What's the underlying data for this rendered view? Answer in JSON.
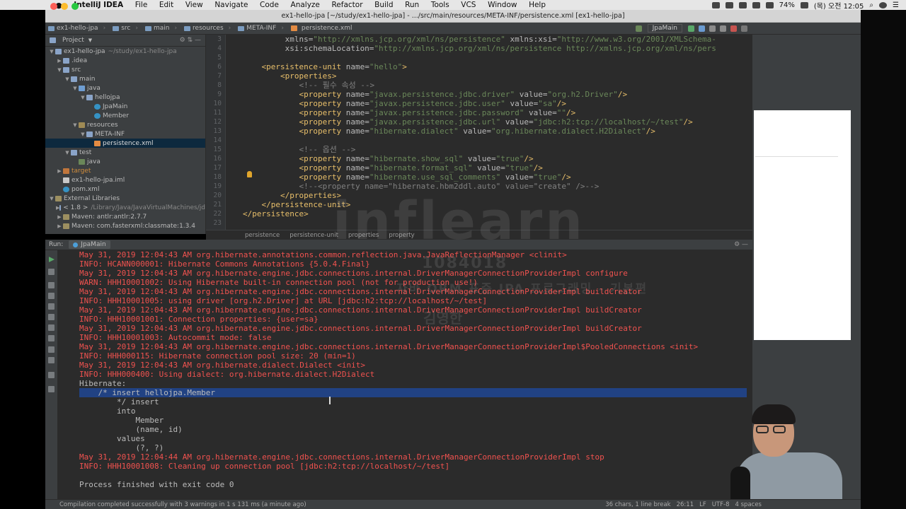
{
  "menubar": {
    "app": "IntelliJ IDEA",
    "items": [
      "File",
      "Edit",
      "View",
      "Navigate",
      "Code",
      "Analyze",
      "Refactor",
      "Build",
      "Run",
      "Tools",
      "VCS",
      "Window",
      "Help"
    ],
    "battery": "74%",
    "clock": "(목) 오전 12:05"
  },
  "window": {
    "title": "ex1-hello-jpa [~/study/ex1-hello-jpa] - .../src/main/resources/META-INF/persistence.xml [ex1-hello-jpa]"
  },
  "breadcrumbs": [
    "ex1-hello-jpa",
    "src",
    "main",
    "resources",
    "META-INF",
    "persistence.xml"
  ],
  "run_config": "JpaMain",
  "project_panel": {
    "title": "Project",
    "tree": [
      {
        "depth": 0,
        "arrow": "▼",
        "icon": "fold",
        "label": "ex1-hello-jpa",
        "extra": "~/study/ex1-hello-jpa"
      },
      {
        "depth": 1,
        "arrow": "▶",
        "icon": "fold",
        "label": ".idea",
        "extra": ""
      },
      {
        "depth": 1,
        "arrow": "▼",
        "icon": "fold",
        "label": "src",
        "extra": ""
      },
      {
        "depth": 2,
        "arrow": "▼",
        "icon": "fold",
        "label": "main",
        "extra": ""
      },
      {
        "depth": 3,
        "arrow": "▼",
        "icon": "src",
        "label": "java",
        "extra": ""
      },
      {
        "depth": 4,
        "arrow": "▼",
        "icon": "fold",
        "label": "hellojpa",
        "extra": ""
      },
      {
        "depth": 5,
        "arrow": "",
        "icon": "cls",
        "label": "JpaMain",
        "extra": ""
      },
      {
        "depth": 5,
        "arrow": "",
        "icon": "cls",
        "label": "Member",
        "extra": ""
      },
      {
        "depth": 3,
        "arrow": "▼",
        "icon": "res",
        "label": "resources",
        "extra": ""
      },
      {
        "depth": 4,
        "arrow": "▼",
        "icon": "fold",
        "label": "META-INF",
        "extra": ""
      },
      {
        "depth": 5,
        "arrow": "",
        "icon": "xml",
        "label": "persistence.xml",
        "extra": "",
        "selected": true
      },
      {
        "depth": 2,
        "arrow": "▼",
        "icon": "fold",
        "label": "test",
        "extra": ""
      },
      {
        "depth": 3,
        "arrow": "",
        "icon": "test",
        "label": "java",
        "extra": ""
      },
      {
        "depth": 1,
        "arrow": "▶",
        "icon": "target",
        "label": "target",
        "extra": "",
        "target": true
      },
      {
        "depth": 1,
        "arrow": "",
        "icon": "file",
        "label": "ex1-hello-jpa.iml",
        "extra": ""
      },
      {
        "depth": 1,
        "arrow": "",
        "icon": "cls",
        "label": "pom.xml",
        "extra": ""
      },
      {
        "depth": 0,
        "arrow": "▼",
        "icon": "lib",
        "label": "External Libraries",
        "extra": ""
      },
      {
        "depth": 1,
        "arrow": "▶",
        "icon": "fold",
        "label": "< 1.8 >",
        "extra": "/Library/Java/JavaVirtualMachines/jd"
      },
      {
        "depth": 1,
        "arrow": "▶",
        "icon": "lib",
        "label": "Maven: antlr:antlr:2.7.7",
        "extra": ""
      },
      {
        "depth": 1,
        "arrow": "▶",
        "icon": "lib",
        "label": "Maven: com.fasterxml:classmate:1.3.4",
        "extra": ""
      }
    ]
  },
  "editor": {
    "line_numbers": [
      "3",
      "4",
      "5",
      "6",
      "7",
      "8",
      "9",
      "10",
      "11",
      "12",
      "13",
      "14",
      "15",
      "16",
      "17",
      "18",
      "19",
      "20",
      "21",
      "22",
      "23"
    ],
    "lines": [
      [
        [
          "att",
          "         xmlns="
        ],
        [
          "val",
          "\"http://xmlns.jcp.org/xml/ns/persistence\""
        ],
        [
          "att",
          " xmlns:xsi="
        ],
        [
          "val",
          "\"http://www.w3.org/2001/XMLSchema-"
        ]
      ],
      [
        [
          "att",
          "         xsi:schemaLocation="
        ],
        [
          "val",
          "\"http://xmlns.jcp.org/xml/ns/persistence http://xmlns.jcp.org/xml/ns/pers"
        ]
      ],
      [
        [
          "att",
          ""
        ]
      ],
      [
        [
          "tag",
          "    <persistence-unit"
        ],
        [
          "att",
          " name="
        ],
        [
          "val",
          "\"hello\""
        ],
        [
          "tag",
          ">"
        ]
      ],
      [
        [
          "tag",
          "        <properties>"
        ]
      ],
      [
        [
          "com",
          "            <!-- 필수 속성 -->"
        ]
      ],
      [
        [
          "tag",
          "            <property"
        ],
        [
          "att",
          " name="
        ],
        [
          "val",
          "\"javax.persistence.jdbc.driver\""
        ],
        [
          "att",
          " value="
        ],
        [
          "val",
          "\"org.h2.Driver\""
        ],
        [
          "tag",
          "/>"
        ]
      ],
      [
        [
          "tag",
          "            <property"
        ],
        [
          "att",
          " name="
        ],
        [
          "val",
          "\"javax.persistence.jdbc.user\""
        ],
        [
          "att",
          " value="
        ],
        [
          "val",
          "\"sa\""
        ],
        [
          "tag",
          "/>"
        ]
      ],
      [
        [
          "tag",
          "            <property"
        ],
        [
          "att",
          " name="
        ],
        [
          "val",
          "\"javax.persistence.jdbc.password\""
        ],
        [
          "att",
          " value="
        ],
        [
          "val",
          "\"\""
        ],
        [
          "tag",
          "/>"
        ]
      ],
      [
        [
          "tag",
          "            <property"
        ],
        [
          "att",
          " name="
        ],
        [
          "val",
          "\"javax.persistence.jdbc.url\""
        ],
        [
          "att",
          " value="
        ],
        [
          "val",
          "\"jdbc:h2:tcp://localhost/~/test\""
        ],
        [
          "tag",
          "/>"
        ]
      ],
      [
        [
          "tag",
          "            <property"
        ],
        [
          "att",
          " name="
        ],
        [
          "val",
          "\"hibernate.dialect\""
        ],
        [
          "att",
          " value="
        ],
        [
          "val",
          "\"org.hibernate.dialect.H2Dialect\""
        ],
        [
          "tag",
          "/>"
        ]
      ],
      [
        [
          "att",
          ""
        ]
      ],
      [
        [
          "com",
          "            <!-- 옵션 -->"
        ]
      ],
      [
        [
          "tag",
          "            <property"
        ],
        [
          "att",
          " name="
        ],
        [
          "val",
          "\"hibernate.show_sql\""
        ],
        [
          "att",
          " value="
        ],
        [
          "val",
          "\"true\""
        ],
        [
          "tag",
          "/>"
        ]
      ],
      [
        [
          "tag",
          "            <property"
        ],
        [
          "att",
          " name="
        ],
        [
          "val",
          "\"hibernate.format_sql\""
        ],
        [
          "att",
          " value="
        ],
        [
          "val",
          "\"true\""
        ],
        [
          "tag",
          "/>"
        ]
      ],
      [
        [
          "tag",
          "            <property"
        ],
        [
          "att",
          " name="
        ],
        [
          "val",
          "\"hibernate.use_sql_comments\""
        ],
        [
          "att",
          " value="
        ],
        [
          "val",
          "\"true\""
        ],
        [
          "tag",
          "/>"
        ]
      ],
      [
        [
          "com",
          "            <!--<property name=\"hibernate.hbm2ddl.auto\" value=\"create\" />-->"
        ]
      ],
      [
        [
          "tag",
          "        </properties>"
        ]
      ],
      [
        [
          "tag",
          "    </persistence-unit>"
        ]
      ],
      [
        [
          "tag",
          "</persistence>"
        ]
      ],
      [
        [
          "att",
          ""
        ]
      ]
    ],
    "crumbs": [
      "persistence",
      "persistence-unit",
      "properties",
      "property"
    ]
  },
  "run_panel": {
    "label": "Run:",
    "tab": "JpaMain",
    "console": [
      {
        "c": "red",
        "t": "May 31, 2019 12:04:43 AM org.hibernate.annotations.common.reflection.java.JavaReflectionManager <clinit>"
      },
      {
        "c": "red",
        "t": "INFO: HCANN000001: Hibernate Commons Annotations {5.0.4.Final}"
      },
      {
        "c": "red",
        "t": "May 31, 2019 12:04:43 AM org.hibernate.engine.jdbc.connections.internal.DriverManagerConnectionProviderImpl configure"
      },
      {
        "c": "red",
        "t": "WARN: HHH10001002: Using Hibernate built-in connection pool (not for production use!)"
      },
      {
        "c": "red",
        "t": "May 31, 2019 12:04:43 AM org.hibernate.engine.jdbc.connections.internal.DriverManagerConnectionProviderImpl buildCreator"
      },
      {
        "c": "red",
        "t": "INFO: HHH10001005: using driver [org.h2.Driver] at URL [jdbc:h2:tcp://localhost/~/test]"
      },
      {
        "c": "red",
        "t": "May 31, 2019 12:04:43 AM org.hibernate.engine.jdbc.connections.internal.DriverManagerConnectionProviderImpl buildCreator"
      },
      {
        "c": "red",
        "t": "INFO: HHH10001001: Connection properties: {user=sa}"
      },
      {
        "c": "red",
        "t": "May 31, 2019 12:04:43 AM org.hibernate.engine.jdbc.connections.internal.DriverManagerConnectionProviderImpl buildCreator"
      },
      {
        "c": "red",
        "t": "INFO: HHH10001003: Autocommit mode: false"
      },
      {
        "c": "red",
        "t": "May 31, 2019 12:04:43 AM org.hibernate.engine.jdbc.connections.internal.DriverManagerConnectionProviderImpl$PooledConnections <init>"
      },
      {
        "c": "red",
        "t": "INFO: HHH000115: Hibernate connection pool size: 20 (min=1)"
      },
      {
        "c": "red",
        "t": "May 31, 2019 12:04:43 AM org.hibernate.dialect.Dialect <init>"
      },
      {
        "c": "red",
        "t": "INFO: HHH000400: Using dialect: org.hibernate.dialect.H2Dialect"
      },
      {
        "c": "out",
        "t": "Hibernate: "
      },
      {
        "c": "out",
        "t": "    /* insert hellojpa.Member"
      },
      {
        "c": "out",
        "t": "        */ insert "
      },
      {
        "c": "out",
        "t": "        into"
      },
      {
        "c": "out",
        "t": "            Member"
      },
      {
        "c": "out",
        "t": "            (name, id) "
      },
      {
        "c": "out",
        "t": "        values"
      },
      {
        "c": "out",
        "t": "            (?, ?)"
      },
      {
        "c": "red",
        "t": "May 31, 2019 12:04:44 AM org.hibernate.engine.jdbc.connections.internal.DriverManagerConnectionProviderImpl stop"
      },
      {
        "c": "red",
        "t": "INFO: HHH10001008: Cleaning up connection pool [jdbc:h2:tcp://localhost/~/test]"
      },
      {
        "c": "out",
        "t": ""
      },
      {
        "c": "out",
        "t": "Process finished with exit code 0"
      }
    ]
  },
  "status_bar": {
    "message": "Compilation completed successfully with 3 warnings in 1 s 131 ms (a minute ago)",
    "selection": "36 chars, 1 line break",
    "position": "26:11",
    "line_sep": "LF",
    "encoding": "UTF-8",
    "indent": "4 spaces"
  },
  "watermark": {
    "brand": "inflearn",
    "id": "1084018",
    "course": "자바 ORM 표준 JPA 프로그래밍 - 기본편",
    "author": "김영한"
  },
  "colors": {
    "editor_bg": "#2b2b2b",
    "panel_bg": "#3c3f41",
    "console_red": "#f0524f",
    "selection": "#214283",
    "xml_tag": "#e8bf6a",
    "xml_value": "#6a8759"
  }
}
